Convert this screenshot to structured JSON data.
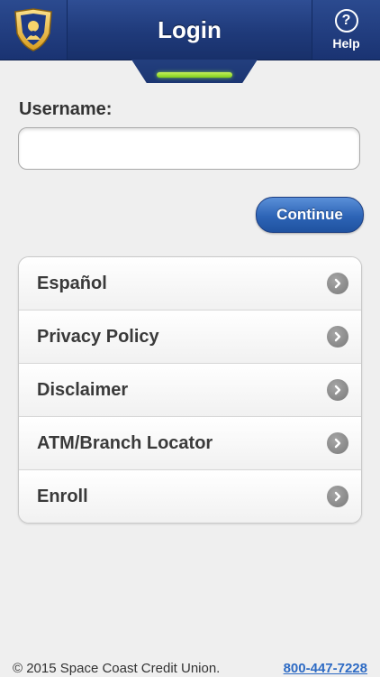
{
  "header": {
    "title": "Login",
    "help_label": "Help",
    "help_glyph": "?",
    "logo_icon": "shield-logo-icon"
  },
  "form": {
    "username_label": "Username:",
    "username_value": "",
    "username_placeholder": "",
    "continue_label": "Continue"
  },
  "menu": {
    "items": [
      {
        "label": "Español"
      },
      {
        "label": "Privacy Policy"
      },
      {
        "label": "Disclaimer"
      },
      {
        "label": "ATM/Branch Locator"
      },
      {
        "label": "Enroll"
      }
    ]
  },
  "footer": {
    "copyright": "© 2015 Space Coast Credit Union.",
    "phone": "800-447-7228"
  },
  "colors": {
    "header_blue": "#1f3a7a",
    "accent_green": "#8bdc2a",
    "button_blue": "#2d64b6",
    "link_blue": "#2e6bc4"
  }
}
